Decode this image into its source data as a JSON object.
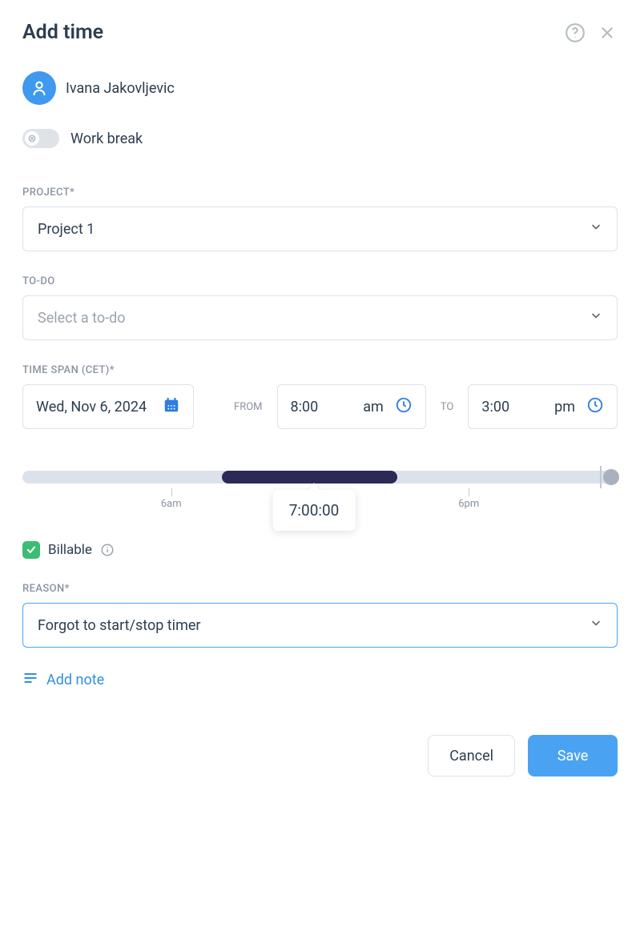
{
  "header": {
    "title": "Add time"
  },
  "user": {
    "name": "Ivana Jakovljevic"
  },
  "workbreak": {
    "label": "Work break",
    "on": false
  },
  "project": {
    "label": "PROJECT*",
    "value": "Project 1"
  },
  "todo": {
    "label": "TO-DO",
    "placeholder": "Select a to-do"
  },
  "timespan": {
    "label": "TIME SPAN (CET)*",
    "date": "Wed, Nov 6, 2024",
    "from_label": "FROM",
    "from_time": "8:00",
    "from_ampm": "am",
    "to_label": "TO",
    "to_time": "3:00",
    "to_ampm": "pm",
    "tick1": "6am",
    "tick2": "6pm",
    "duration": "7:00:00"
  },
  "billable": {
    "label": "Billable",
    "checked": true
  },
  "reason": {
    "label": "REASON*",
    "value": "Forgot to start/stop timer"
  },
  "addnote": {
    "label": "Add note"
  },
  "footer": {
    "cancel": "Cancel",
    "save": "Save"
  }
}
